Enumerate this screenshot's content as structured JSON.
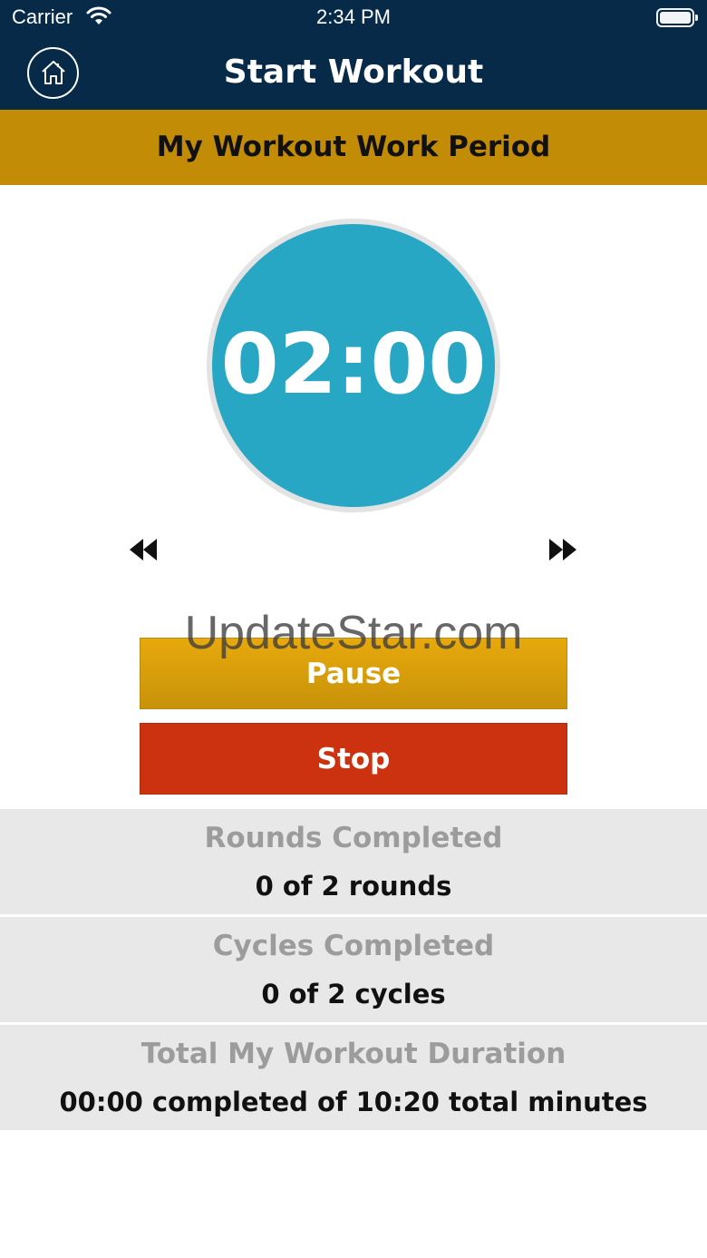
{
  "status_bar": {
    "carrier": "Carrier",
    "time": "2:34 PM"
  },
  "nav": {
    "title": "Start Workout",
    "home_icon": "home-icon"
  },
  "period": {
    "title": "My Workout Work Period"
  },
  "timer": {
    "display": "02:00"
  },
  "controls": {
    "previous_icon": "rewind-icon",
    "next_icon": "fast-forward-icon",
    "pause_label": "Pause",
    "stop_label": "Stop"
  },
  "watermark": "UpdateStar.com",
  "stats": {
    "rounds": {
      "label": "Rounds Completed",
      "value": "0 of 2 rounds"
    },
    "cycles": {
      "label": "Cycles Completed",
      "value": "0 of 2 cycles"
    },
    "duration": {
      "label": "Total My Workout Duration",
      "value": "00:00 completed of 10:20 total minutes"
    }
  },
  "colors": {
    "nav_bg": "#062a47",
    "period_bg": "#c38c07",
    "timer_bg": "#27a7c4",
    "pause_bg": "#e0a20b",
    "stop_bg": "#cc320f",
    "stats_bg": "#e8e8e8"
  }
}
